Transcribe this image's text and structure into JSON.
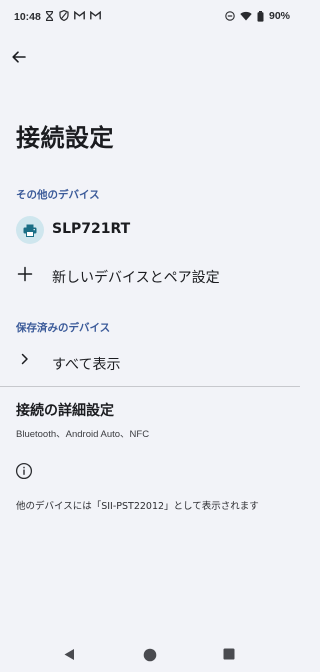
{
  "status_bar": {
    "time": "10:48",
    "battery": "90%"
  },
  "page": {
    "title": "接続設定"
  },
  "other_devices": {
    "header": "その他のデバイス",
    "items": [
      {
        "label": "SLP721RT",
        "icon": "printer-icon"
      }
    ],
    "pair_new_label": "新しいデバイスとペア設定"
  },
  "saved_devices": {
    "header": "保存済みのデバイス",
    "see_all_label": "すべて表示"
  },
  "advanced": {
    "title": "接続の詳細設定",
    "subtitle": "Bluetooth、Android Auto、NFC"
  },
  "info": {
    "text": "他のデバイスには「SII-PST22012」として表示されます"
  },
  "colors": {
    "background": "#f2f3f8",
    "section_header": "#3c5b9a",
    "printer_icon_bg": "#cfe6ee",
    "printer_icon_fg": "#1a6e86"
  }
}
